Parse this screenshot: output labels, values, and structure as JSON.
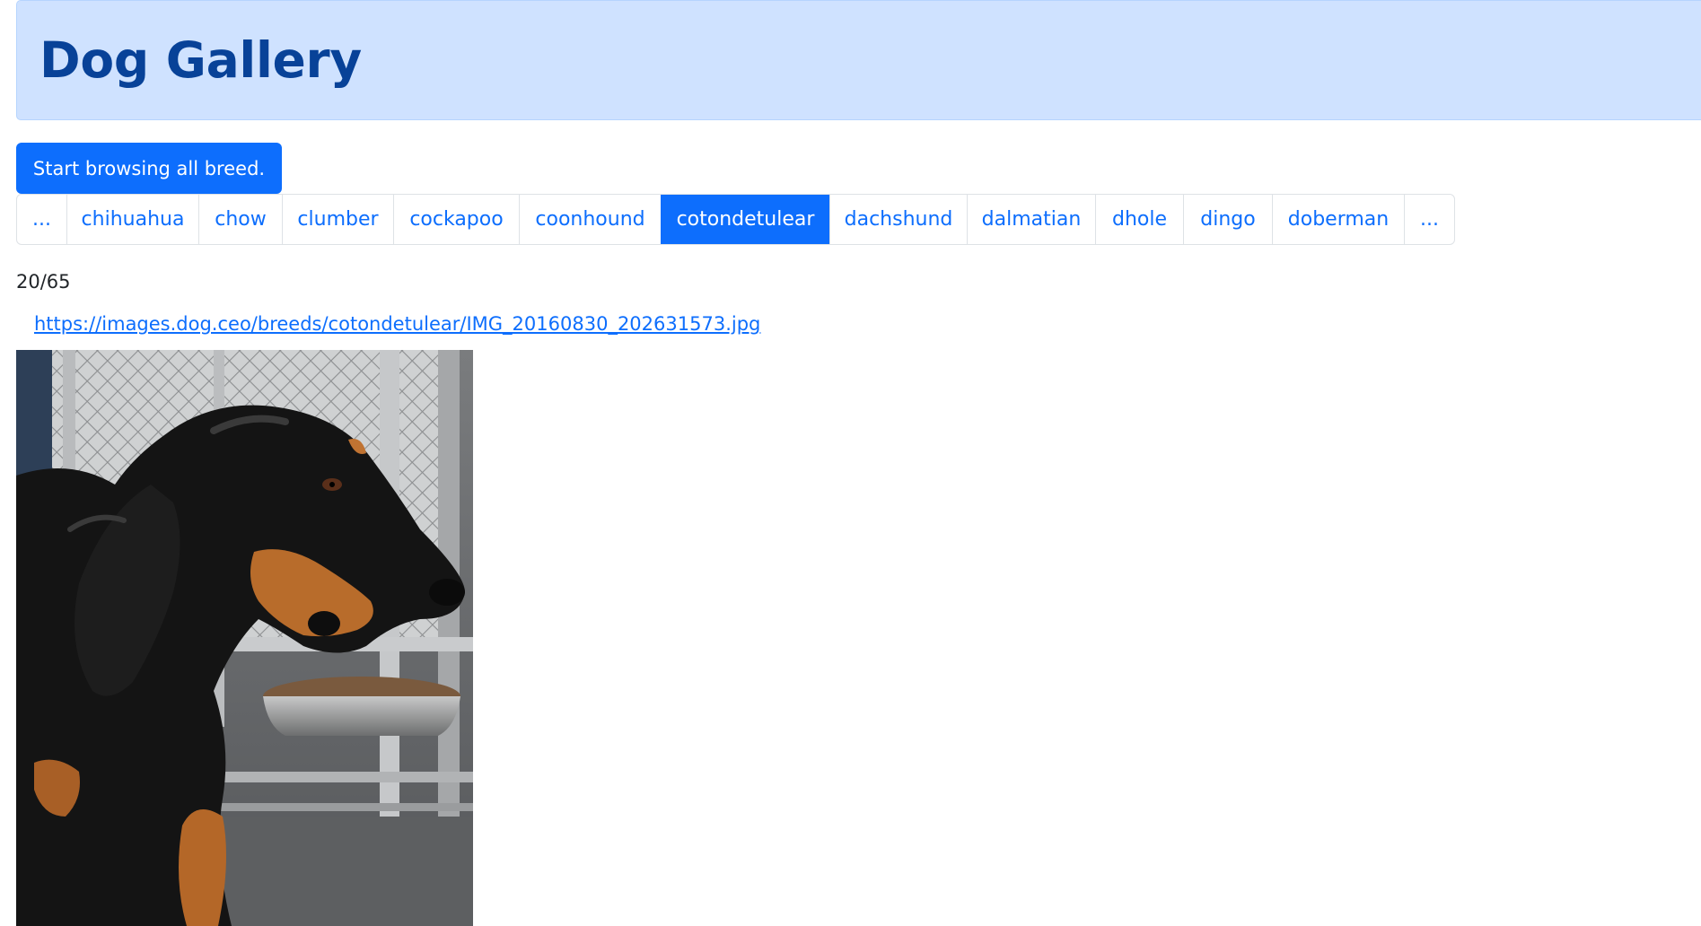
{
  "header": {
    "title": "Dog Gallery"
  },
  "start_button": {
    "label": "Start browsing all breed."
  },
  "pagination": {
    "items": [
      {
        "label": "...",
        "active": false
      },
      {
        "label": "chihuahua",
        "active": false
      },
      {
        "label": "chow",
        "active": false
      },
      {
        "label": "clumber",
        "active": false
      },
      {
        "label": "cockapoo",
        "active": false
      },
      {
        "label": "coonhound",
        "active": false
      },
      {
        "label": "cotondetulear",
        "active": true
      },
      {
        "label": "dachshund",
        "active": false
      },
      {
        "label": "dalmatian",
        "active": false
      },
      {
        "label": "dhole",
        "active": false
      },
      {
        "label": "dingo",
        "active": false
      },
      {
        "label": "doberman",
        "active": false
      },
      {
        "label": "...",
        "active": false
      }
    ]
  },
  "gallery": {
    "counter": "20/65",
    "image_url": "https://images.dog.ceo/breeds/cotondetulear/IMG_20160830_202631573.jpg",
    "image_subject": "black-and-tan-dog-photo"
  },
  "colors": {
    "primary": "#0d6efd",
    "header_bg": "#cfe2ff",
    "header_text": "#084298"
  }
}
